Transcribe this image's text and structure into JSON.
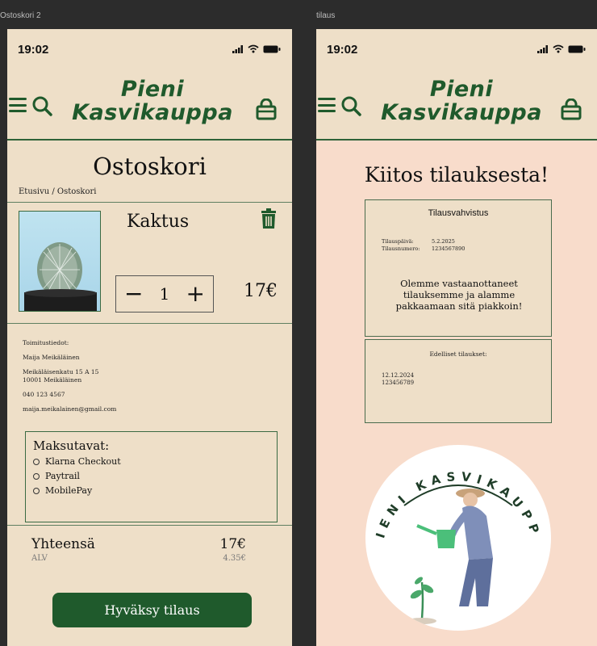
{
  "frames": {
    "cart_label": "Ostoskori 2",
    "order_label": "tilaus"
  },
  "status": {
    "time": "19:02"
  },
  "brand": {
    "line1": "Pieni",
    "line2": "Kasvikauppa",
    "color": "#1f5a2c",
    "emblem_text": "PIENI KASVIKAUPPA"
  },
  "cart": {
    "title": "Ostoskori",
    "breadcrumb": "Etusivu / Ostoskori",
    "product": {
      "name": "Kaktus",
      "quantity": "1",
      "price": "17€",
      "minus": "−",
      "plus": "+"
    },
    "shipping": {
      "heading": "Toimitustiedot:",
      "name": "Maija Meikäläinen",
      "street": "Meikäläisenkatu 15 A 15",
      "postal": "10001 Meikäläinen",
      "phone": "040 123 4567",
      "email": "maija.meikalainen@gmail.com"
    },
    "payment": {
      "title": "Maksutavat:",
      "options": [
        "Klarna Checkout",
        "Paytrail",
        "MobilePay"
      ]
    },
    "totals": {
      "label": "Yhteensä",
      "value": "17€",
      "vat_label": "ALV",
      "vat_value": "4.35€"
    },
    "accept_button": "Hyväksy tilaus"
  },
  "order": {
    "thanks": "Kiitos tilauksesta!",
    "confirmation": {
      "title": "Tilausvahvistus",
      "date_label": "Tilauspäivä:",
      "date_value": "5.2.2025",
      "number_label": "Tilausnumero:",
      "number_value": "1234567890",
      "message": "Olemme vastaanottaneet tilauksemme ja alamme pakkaamaan sitä piakkoin!"
    },
    "history": {
      "title": "Edelliset tilaukset:",
      "date": "12.12.2024",
      "number": "123456789"
    }
  }
}
